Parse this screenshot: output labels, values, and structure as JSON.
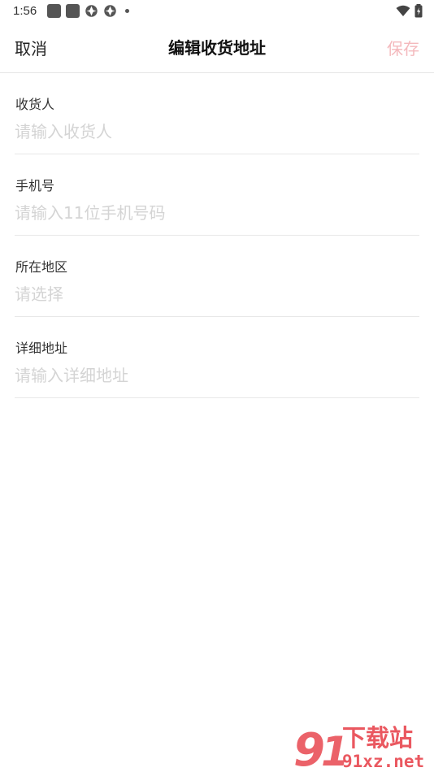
{
  "status_bar": {
    "time": "1:56"
  },
  "header": {
    "cancel_label": "取消",
    "title": "编辑收货地址",
    "save_label": "保存"
  },
  "form": {
    "fields": [
      {
        "label": "收货人",
        "placeholder": "请输入收货人"
      },
      {
        "label": "手机号",
        "placeholder": "请输入11位手机号码"
      },
      {
        "label": "所在地区",
        "placeholder": "请选择"
      },
      {
        "label": "详细地址",
        "placeholder": "请输入详细地址"
      }
    ]
  },
  "watermark": {
    "brand": "下载站",
    "domain": "91xz.net"
  },
  "colors": {
    "save_disabled": "#f4b9bd",
    "placeholder": "#d4d4d4",
    "watermark_red": "#e8474f"
  }
}
